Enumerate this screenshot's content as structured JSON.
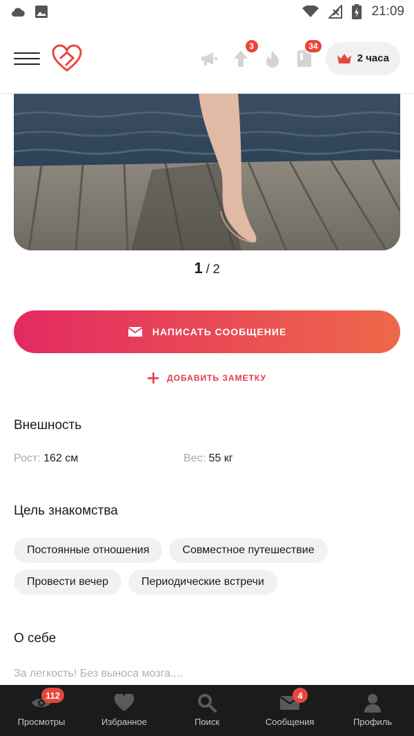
{
  "status_bar": {
    "time": "21:09",
    "left_icons": [
      "cloud-icon",
      "image-icon"
    ],
    "right_icons": [
      "wifi-icon",
      "no-signal-icon",
      "battery-charging-icon"
    ]
  },
  "header": {
    "icons": [
      {
        "name": "megaphone-icon",
        "badge": ""
      },
      {
        "name": "boost-up-icon",
        "badge": "3"
      },
      {
        "name": "fire-icon",
        "badge": ""
      },
      {
        "name": "book-icon",
        "badge": "34"
      }
    ],
    "vip_label": "2 часа"
  },
  "photo": {
    "pager_current": "1",
    "pager_total": "/ 2"
  },
  "actions": {
    "message_label": "НАПИСАТЬ СООБЩЕНИЕ",
    "note_label": "ДОБАВИТЬ ЗАМЕТКУ"
  },
  "appearance": {
    "title": "Внешность",
    "height_label": "Рост:",
    "height_value": "162 см",
    "weight_label": "Вес:",
    "weight_value": "55 кг"
  },
  "goals": {
    "title": "Цель знакомства",
    "chips": [
      "Постоянные отношения",
      "Совместное путешествие",
      "Провести вечер",
      "Периодические встречи"
    ]
  },
  "about": {
    "title": "О себе",
    "text": "За легкость! Без выноса мозга...."
  },
  "bottom_nav": {
    "items": [
      {
        "label": "Просмотры",
        "icon": "eye-icon",
        "badge": "112"
      },
      {
        "label": "Избранное",
        "icon": "heart-icon",
        "badge": ""
      },
      {
        "label": "Поиск",
        "icon": "search-icon",
        "badge": ""
      },
      {
        "label": "Сообщения",
        "icon": "mail-icon",
        "badge": "4"
      },
      {
        "label": "Профиль",
        "icon": "profile-icon",
        "badge": ""
      }
    ]
  },
  "colors": {
    "accent": "#e8463a",
    "gradient_start": "#e32a61",
    "gradient_end": "#ee684a",
    "nav_bg": "#1b1b1b"
  }
}
